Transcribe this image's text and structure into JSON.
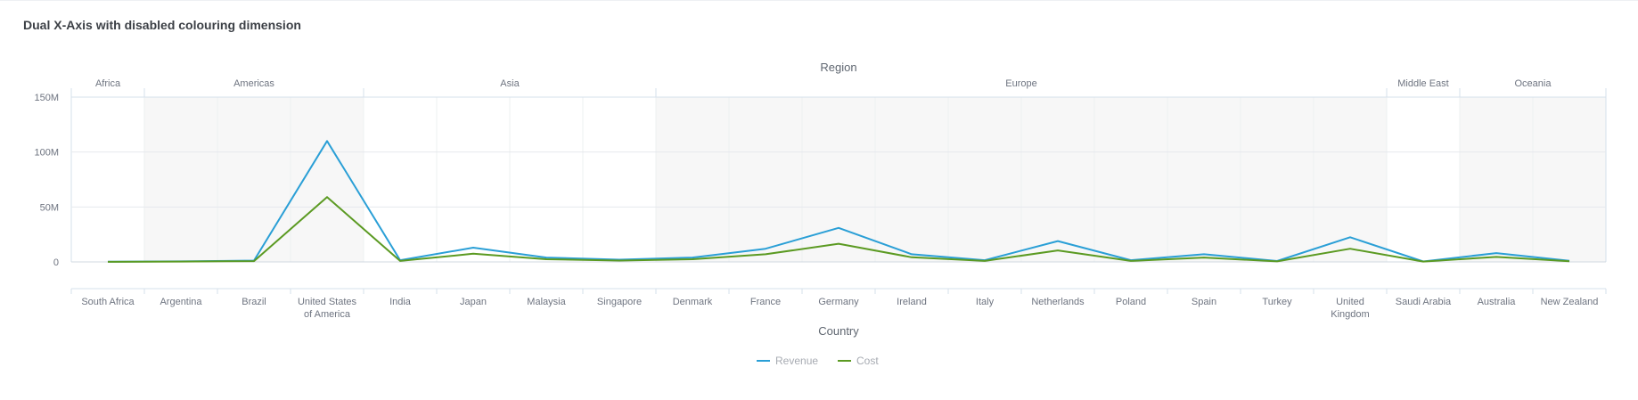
{
  "page": {
    "title": "Dual X-Axis with disabled colouring dimension"
  },
  "chart_data": {
    "type": "line",
    "title": "Dual X-Axis with disabled colouring dimension",
    "secondary_xlabel": "Region",
    "xlabel": "Country",
    "ylabel": "",
    "ylim": [
      0,
      150000000
    ],
    "y_ticks": [
      {
        "value": 0,
        "label": "0"
      },
      {
        "value": 50000000,
        "label": "50M"
      },
      {
        "value": 100000000,
        "label": "100M"
      },
      {
        "value": 150000000,
        "label": "150M"
      }
    ],
    "grid": true,
    "legend_position": "bottom",
    "groups": [
      {
        "name": "Africa",
        "count": 1,
        "shaded": false
      },
      {
        "name": "Americas",
        "count": 3,
        "shaded": true
      },
      {
        "name": "Asia",
        "count": 4,
        "shaded": false
      },
      {
        "name": "Europe",
        "count": 10,
        "shaded": true
      },
      {
        "name": "Middle East",
        "count": 1,
        "shaded": false
      },
      {
        "name": "Oceania",
        "count": 2,
        "shaded": true
      }
    ],
    "categories": [
      "South Africa",
      "Argentina",
      "Brazil",
      "United States of America",
      "India",
      "Japan",
      "Malaysia",
      "Singapore",
      "Denmark",
      "France",
      "Germany",
      "Ireland",
      "Italy",
      "Netherlands",
      "Poland",
      "Spain",
      "Turkey",
      "United Kingdom",
      "Saudi Arabia",
      "Australia",
      "New Zealand"
    ],
    "category_lines": [
      [
        "South Africa"
      ],
      [
        "Argentina"
      ],
      [
        "Brazil"
      ],
      [
        "United States",
        "of America"
      ],
      [
        "India"
      ],
      [
        "Japan"
      ],
      [
        "Malaysia"
      ],
      [
        "Singapore"
      ],
      [
        "Denmark"
      ],
      [
        "France"
      ],
      [
        "Germany"
      ],
      [
        "Ireland"
      ],
      [
        "Italy"
      ],
      [
        "Netherlands"
      ],
      [
        "Poland"
      ],
      [
        "Spain"
      ],
      [
        "Turkey"
      ],
      [
        "United",
        "Kingdom"
      ],
      [
        "Saudi Arabia"
      ],
      [
        "Australia"
      ],
      [
        "New Zealand"
      ]
    ],
    "series": [
      {
        "name": "Revenue",
        "color": "#2a9fd6",
        "values": [
          200000,
          500000,
          1200000,
          110000000,
          1500000,
          13000000,
          4000000,
          2000000,
          4000000,
          12000000,
          31000000,
          7000000,
          1500000,
          19000000,
          1500000,
          7000000,
          800000,
          22500000,
          400000,
          8000000,
          1000000
        ]
      },
      {
        "name": "Cost",
        "color": "#5b9a22",
        "values": [
          100000,
          300000,
          700000,
          59000000,
          900000,
          7500000,
          2400000,
          1200000,
          2400000,
          7000000,
          16500000,
          4200000,
          900000,
          10500000,
          900000,
          4000000,
          500000,
          12000000,
          300000,
          4500000,
          600000
        ]
      }
    ]
  }
}
